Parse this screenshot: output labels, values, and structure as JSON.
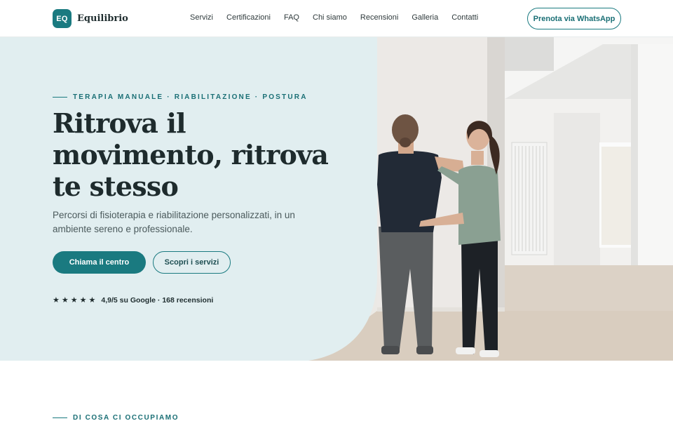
{
  "header": {
    "logo_badge": "EQ",
    "brand_name": "Equilibrio",
    "nav": [
      "Servizi",
      "Certificazioni",
      "FAQ",
      "Chi siamo",
      "Recensioni",
      "Galleria",
      "Contatti"
    ],
    "cta": "Prenota via WhatsApp"
  },
  "hero": {
    "eyebrow": "TERAPIA MANUALE · RIABILITAZIONE · POSTURA",
    "headline": "Ritrova il movimento, ritrova te stesso",
    "subtitle": "Percorsi di fisioterapia e riabilitazione personalizzati, in un ambiente sereno e professionale.",
    "primary_button": "Chiama il centro",
    "secondary_button": "Scopri i servizi",
    "stars": [
      "★",
      "★",
      "★",
      "★",
      "★"
    ],
    "rating_text": "4,9/5 su Google · 168 recensioni"
  },
  "section": {
    "eyebrow": "DI COSA CI OCCUPIAMO"
  },
  "colors": {
    "accent": "#1a7a80",
    "hero_bg": "#e1eef0",
    "text_dark": "#1e2b2d"
  }
}
